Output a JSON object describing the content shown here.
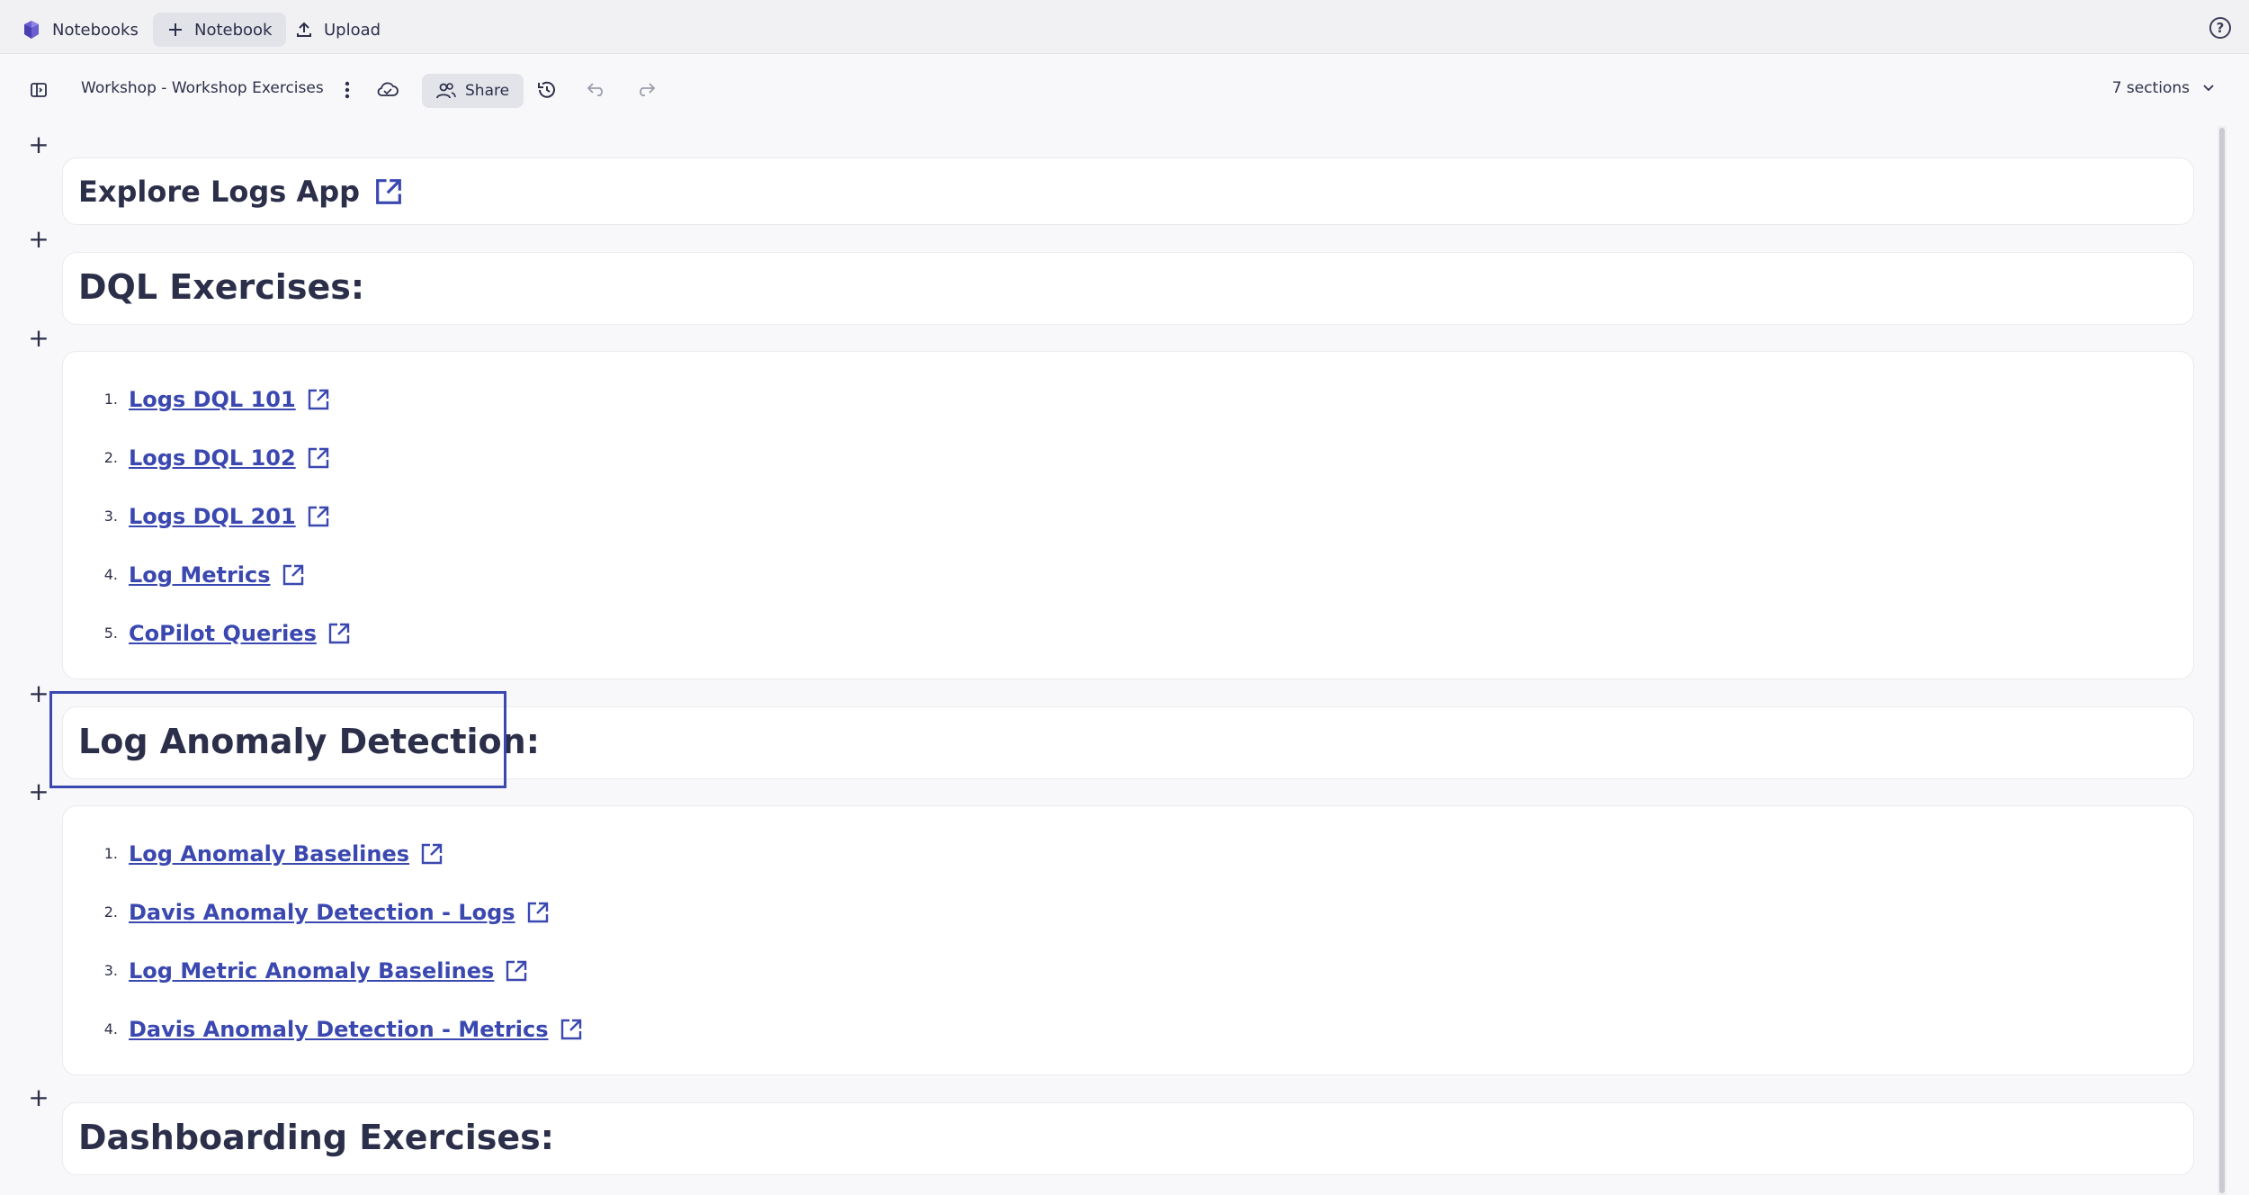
{
  "appbar": {
    "notebooks_label": "Notebooks",
    "new_notebook_label": "Notebook",
    "upload_label": "Upload"
  },
  "toolbar": {
    "title": "Workshop - Workshop Exercises",
    "share_label": "Share",
    "sections_label": "7 sections"
  },
  "sections": {
    "explore": {
      "title": "Explore Logs App"
    },
    "dql": {
      "title": "DQL Exercises:"
    },
    "dql_list": [
      {
        "num": "1.",
        "label": "Logs DQL 101"
      },
      {
        "num": "2.",
        "label": "Logs DQL 102"
      },
      {
        "num": "3.",
        "label": "Logs DQL 201"
      },
      {
        "num": "4.",
        "label": "Log Metrics"
      },
      {
        "num": "5.",
        "label": "CoPilot Queries"
      }
    ],
    "anomaly": {
      "title": "Log Anomaly Detection:"
    },
    "anomaly_list": [
      {
        "num": "1.",
        "label": "Log Anomaly Baselines"
      },
      {
        "num": "2.",
        "label": "Davis Anomaly Detection - Logs"
      },
      {
        "num": "3.",
        "label": "Log Metric Anomaly Baselines"
      },
      {
        "num": "4.",
        "label": "Davis Anomaly Detection - Metrics"
      }
    ],
    "dashboarding": {
      "title": "Dashboarding Exercises:"
    }
  },
  "colors": {
    "link": "#3a48b0",
    "selection": "#3a48b0",
    "text": "#2c2f4a"
  }
}
